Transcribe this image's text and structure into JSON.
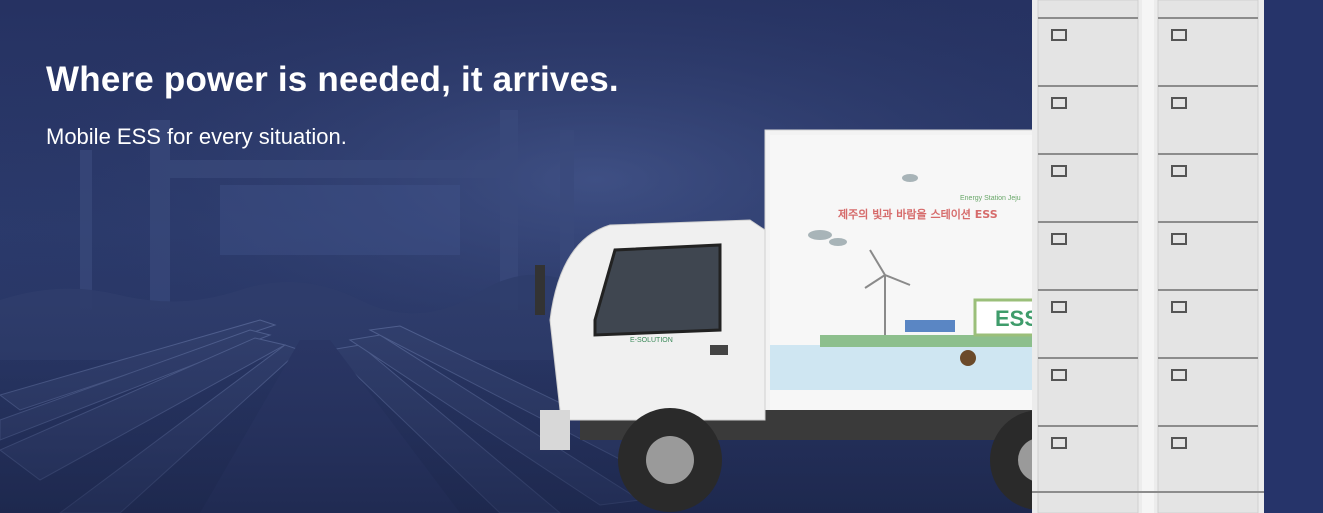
{
  "hero": {
    "headline": "Where power is needed, it arrives.",
    "subheadline": "Mobile ESS for every situation."
  },
  "truck": {
    "cargo_heading": "제주의 빛과 바람을 스테이션 ESS",
    "cargo_small": "Energy Station Jeju",
    "cargo_ess_sign": "ESS",
    "door_logo": "E-SOLUTION"
  },
  "colors": {
    "background": "#2a3660",
    "text": "#ffffff",
    "truck_body": "#f1f1f1",
    "ess_rack": "#e8e8e8"
  }
}
